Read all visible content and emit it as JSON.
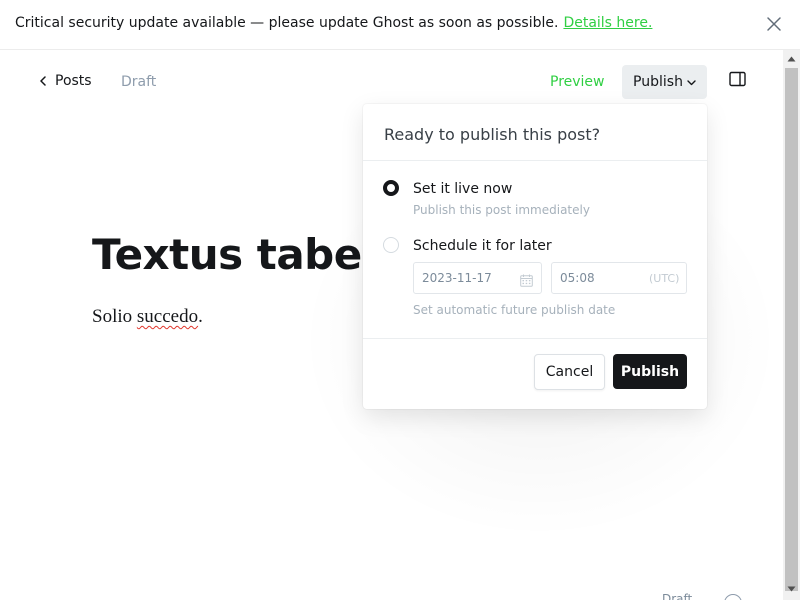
{
  "banner": {
    "message": "Critical security update available — please update Ghost as soon as possible.",
    "link_label": "Details here."
  },
  "header": {
    "back_label": "Posts",
    "status": "Draft",
    "preview_label": "Preview",
    "publish_label": "Publish"
  },
  "editor": {
    "title": "Textus tabes",
    "body_word1": "Solio",
    "body_word2": "succedo",
    "body_end": "."
  },
  "publish_menu": {
    "title": "Ready to publish this post?",
    "option_now": {
      "label": "Set it live now",
      "description": "Publish this post immediately",
      "selected": true
    },
    "option_schedule": {
      "label": "Schedule it for later",
      "selected": false
    },
    "date_value": "2023-11-17",
    "time_value": "05:08",
    "timezone": "(UTC)",
    "date_help": "Set automatic future publish date",
    "cancel_label": "Cancel",
    "publish_label": "Publish"
  },
  "footer": {
    "word_count_partial": "Draft"
  },
  "colors": {
    "accent_green": "#30cf43",
    "dark": "#15171a",
    "muted": "#8e9cac"
  },
  "icons": [
    "close-icon",
    "chevron-left-icon",
    "chevron-down-icon",
    "sidebar-panel-icon",
    "calendar-icon",
    "help-icon"
  ]
}
